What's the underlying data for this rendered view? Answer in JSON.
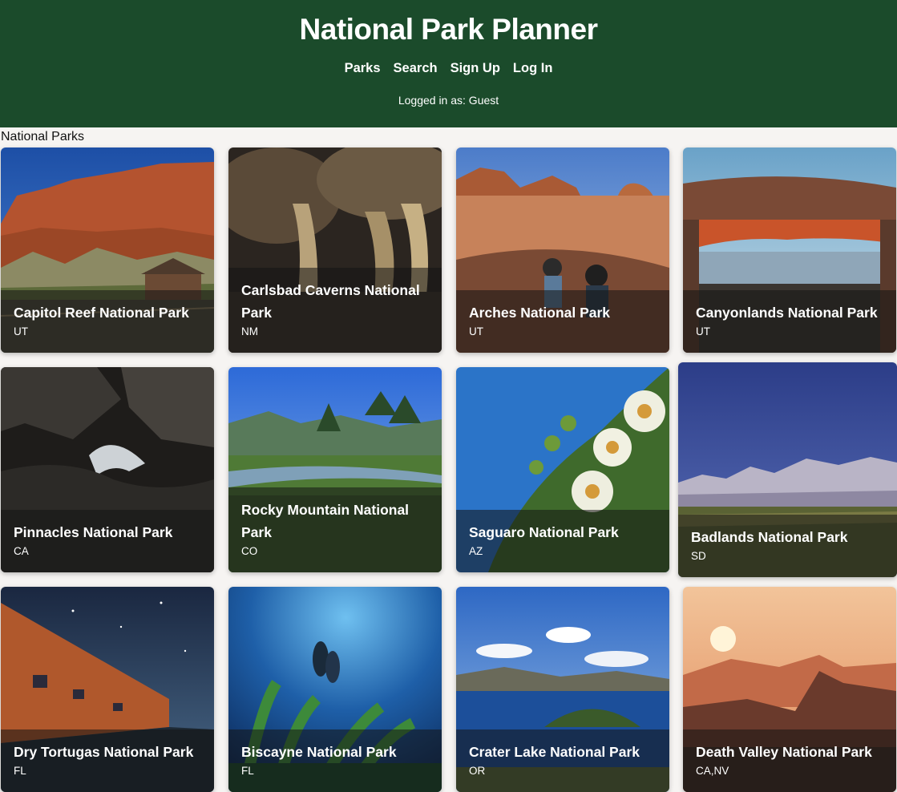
{
  "header": {
    "title": "National Park Planner",
    "nav": [
      "Parks",
      "Search",
      "Sign Up",
      "Log In"
    ],
    "login_status": "Logged in as: Guest"
  },
  "main": {
    "heading": "National Parks",
    "parks": [
      {
        "name": "Capitol Reef National Park",
        "state": "UT"
      },
      {
        "name": "Carlsbad Caverns National Park",
        "state": "NM"
      },
      {
        "name": "Arches National Park",
        "state": "UT"
      },
      {
        "name": "Canyonlands National Park",
        "state": "UT"
      },
      {
        "name": "Pinnacles National Park",
        "state": "CA"
      },
      {
        "name": "Rocky Mountain National Park",
        "state": "CO"
      },
      {
        "name": "Saguaro National Park",
        "state": "AZ"
      },
      {
        "name": "Badlands National Park",
        "state": "SD"
      },
      {
        "name": "Dry Tortugas National Park",
        "state": "FL"
      },
      {
        "name": "Biscayne National Park",
        "state": "FL"
      },
      {
        "name": "Crater Lake National Park",
        "state": "OR"
      },
      {
        "name": "Death Valley National Park",
        "state": "CA,NV"
      }
    ]
  },
  "colors": {
    "header_bg": "#1b4b2b",
    "page_bg": "#f6f4f2"
  }
}
